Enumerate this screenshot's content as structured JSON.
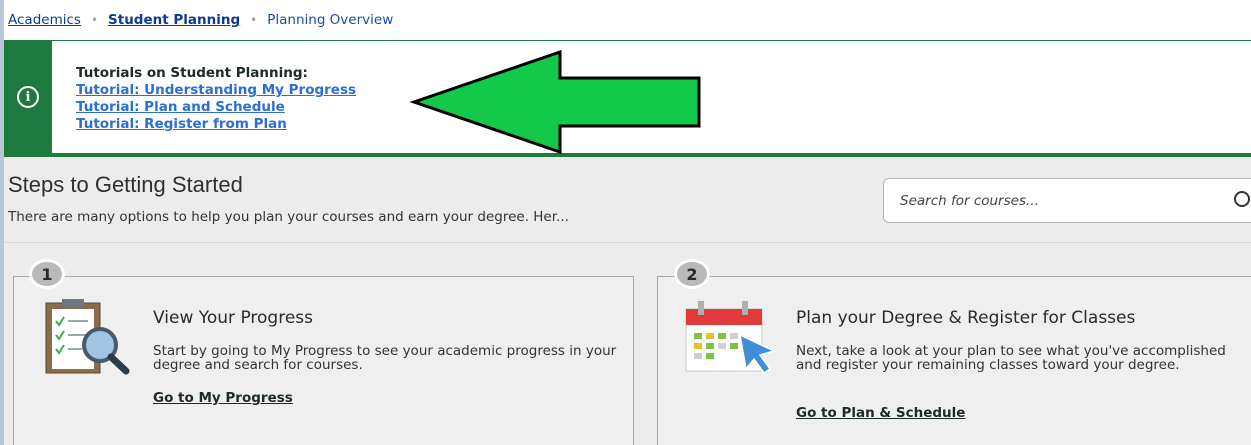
{
  "breadcrumb": {
    "items": [
      "Academics",
      "Student Planning",
      "Planning Overview"
    ]
  },
  "alert": {
    "title": "Tutorials on Student Planning:",
    "links": [
      "Tutorial: Understanding My Progress",
      "Tutorial: Plan and Schedule",
      "Tutorial: Register from Plan"
    ],
    "accent_color": "#1e7a3e",
    "arrow_color": "#12c94a"
  },
  "steps": {
    "title": "Steps to Getting Started",
    "description": "There are many options to help you plan your courses and earn your degree. Her..."
  },
  "search": {
    "placeholder": "Search for courses..."
  },
  "cards": [
    {
      "number": "1",
      "title": "View Your Progress",
      "text": "Start by going to My Progress to see your academic progress in your degree and search for courses.",
      "link": "Go to My Progress",
      "icon": "clipboard-magnifier-icon"
    },
    {
      "number": "2",
      "title": "Plan your Degree & Register for Classes",
      "text": "Next, take a look at your plan to see what you've accomplished and register your remaining classes toward your degree.",
      "link": "Go to Plan & Schedule",
      "icon": "calendar-cursor-icon"
    }
  ]
}
